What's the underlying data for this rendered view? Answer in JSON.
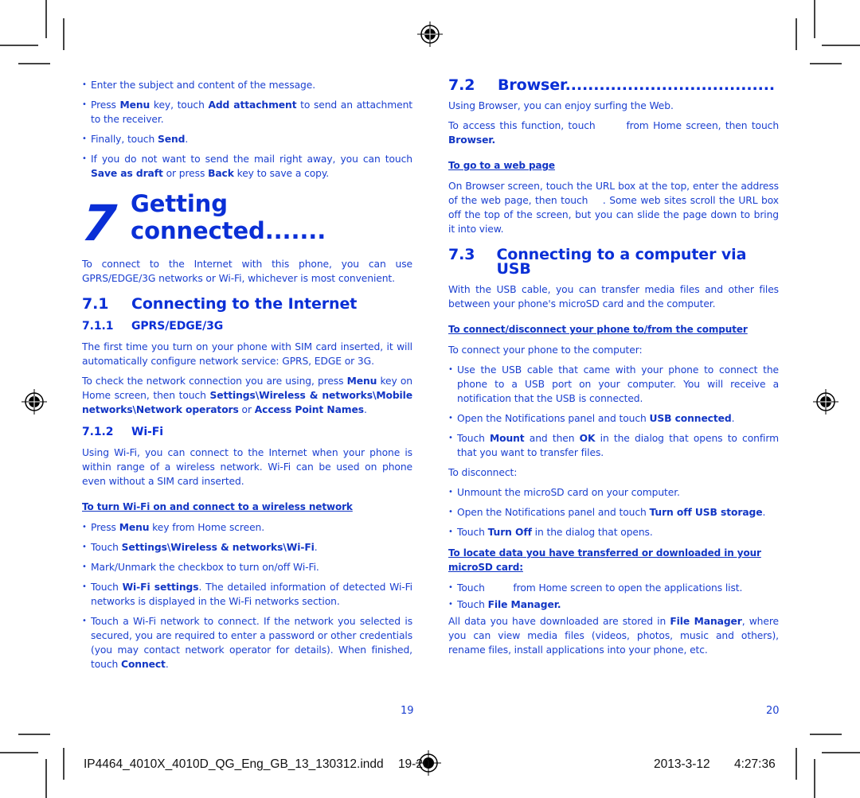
{
  "left": {
    "bullets_top": [
      {
        "parts": [
          [
            "t",
            "Enter the subject and content of the message."
          ]
        ]
      },
      {
        "parts": [
          [
            "t",
            "Press "
          ],
          [
            "b",
            "Menu"
          ],
          [
            "t",
            " key, touch "
          ],
          [
            "b",
            "Add attachment"
          ],
          [
            "t",
            " to send an attachment to the receiver."
          ]
        ]
      },
      {
        "parts": [
          [
            "t",
            "Finally, touch "
          ],
          [
            "b",
            "Send"
          ],
          [
            "t",
            "."
          ]
        ]
      },
      {
        "parts": [
          [
            "t",
            "If you do not want to send the mail right away, you can touch "
          ],
          [
            "b",
            "Save as draft"
          ],
          [
            "t",
            " or press "
          ],
          [
            "b",
            "Back"
          ],
          [
            "t",
            " key to save a copy."
          ]
        ]
      }
    ],
    "chapter_number": "7",
    "chapter_title": "Getting connected.......",
    "chapter_intro": "To connect to the Internet with this phone, you can use GPRS/EDGE/3G networks or Wi-Fi, whichever is most convenient.",
    "s71_num": "7.1",
    "s71_title": "Connecting to the Internet",
    "s711_num": "7.1.1",
    "s711_title": "GPRS/EDGE/3G",
    "s711_p1": "The first time you turn on your phone with SIM card inserted, it will automatically configure network service: GPRS, EDGE or 3G.",
    "s711_p2": [
      [
        "t",
        "To check the network connection you are using, press "
      ],
      [
        "b",
        "Menu"
      ],
      [
        "t",
        " key on Home screen, then touch "
      ],
      [
        "b",
        "Settings\\Wireless & networks\\Mobile networks\\Network operators"
      ],
      [
        "t",
        " or "
      ],
      [
        "b",
        "Access Point Names"
      ],
      [
        "t",
        "."
      ]
    ],
    "s712_num": "7.1.2",
    "s712_title": "Wi-Fi",
    "s712_p1": "Using Wi-Fi, you can connect to the Internet when your phone is within range of a wireless network. Wi-Fi can be used on phone even without a SIM card inserted.",
    "wifi_link": "To turn Wi-Fi on and connect to a wireless network",
    "wifi_bullets": [
      {
        "parts": [
          [
            "t",
            "Press "
          ],
          [
            "b",
            "Menu"
          ],
          [
            "t",
            " key from Home screen."
          ]
        ]
      },
      {
        "parts": [
          [
            "t",
            "Touch "
          ],
          [
            "b",
            "Settings\\Wireless & networks\\Wi-Fi"
          ],
          [
            "t",
            "."
          ]
        ]
      },
      {
        "parts": [
          [
            "t",
            "Mark/Unmark the checkbox to turn on/off Wi-Fi."
          ]
        ]
      },
      {
        "parts": [
          [
            "t",
            "Touch "
          ],
          [
            "b",
            "Wi-Fi settings"
          ],
          [
            "t",
            ". The detailed information of detected Wi-Fi networks is displayed in the Wi-Fi networks section."
          ]
        ]
      },
      {
        "parts": [
          [
            "t",
            "Touch a Wi-Fi network to connect. If the network you selected is secured, you are required to enter a password or other credentials (you may contact network operator for details). When finished, touch "
          ],
          [
            "b",
            "Connect"
          ],
          [
            "t",
            "."
          ]
        ]
      }
    ],
    "page_number": "19"
  },
  "right": {
    "s72_num": "7.2",
    "s72_title": "Browser.....................................",
    "s72_p1": "Using Browser, you can enjoy surfing the Web.",
    "s72_p2a": "To access this function, touch",
    "s72_p2b": "from Home screen, then touch",
    "s72_p2c": "Browser.",
    "web_link": "To go to a web page",
    "web_p_a": "On Browser screen, touch the URL box at the top, enter the address of the web page, then touch",
    "web_p_b": ". Some web sites scroll the URL box off the top of the screen, but you can slide the page down to bring it into view.",
    "s73_num": "7.3",
    "s73_title": "Connecting to a computer via USB",
    "s73_p1": "With the USB cable, you can transfer media files and other files between your phone's microSD card and the computer.",
    "usb_link": "To connect/disconnect your phone to/from the computer",
    "usb_connect_intro": "To connect your phone to the computer:",
    "usb_connect_bullets": [
      {
        "parts": [
          [
            "t",
            "Use the USB cable that came with your phone to connect the phone to a USB port on your computer. You will receive a notification that the USB is connected."
          ]
        ]
      },
      {
        "parts": [
          [
            "t",
            "Open the Notifications panel and touch "
          ],
          [
            "b",
            "USB connected"
          ],
          [
            "t",
            "."
          ]
        ]
      },
      {
        "parts": [
          [
            "t",
            "Touch "
          ],
          [
            "b",
            "Mount"
          ],
          [
            "t",
            " and then "
          ],
          [
            "b",
            "OK"
          ],
          [
            "t",
            " in the dialog that opens to confirm that you want to transfer files."
          ]
        ]
      }
    ],
    "usb_disconnect_intro": "To disconnect:",
    "usb_disconnect_bullets": [
      {
        "parts": [
          [
            "t",
            "Unmount the microSD card on your computer."
          ]
        ]
      },
      {
        "parts": [
          [
            "t",
            "Open the Notifications panel and touch "
          ],
          [
            "b",
            "Turn off USB storage"
          ],
          [
            "t",
            "."
          ]
        ]
      },
      {
        "parts": [
          [
            "t",
            "Touch "
          ],
          [
            "b",
            "Turn Off"
          ],
          [
            "t",
            " in the dialog that opens."
          ]
        ]
      }
    ],
    "locate_link": "To locate data you have transferred or downloaded in your microSD card:",
    "locate_bullet1_a": "Touch",
    "locate_bullet1_b": "from Home screen to open the applications list.",
    "locate_bullet2": [
      [
        "t",
        "Touch "
      ],
      [
        "b",
        "File Manager."
      ]
    ],
    "locate_p": [
      [
        "t",
        "All data you have downloaded are stored in "
      ],
      [
        "b",
        "File Manager"
      ],
      [
        "t",
        ", where you can view media files (videos, photos, music and others), rename files, install applications into your phone, etc."
      ]
    ],
    "page_number": "20"
  },
  "slug": {
    "filename": "IP4464_4010X_4010D_QG_Eng_GB_13_130312.indd",
    "pages": "19-20",
    "date": "2013-3-12",
    "time": "4:27:36"
  },
  "colors": {
    "text": "#1a3fd0",
    "heading": "#0a2fd6"
  }
}
